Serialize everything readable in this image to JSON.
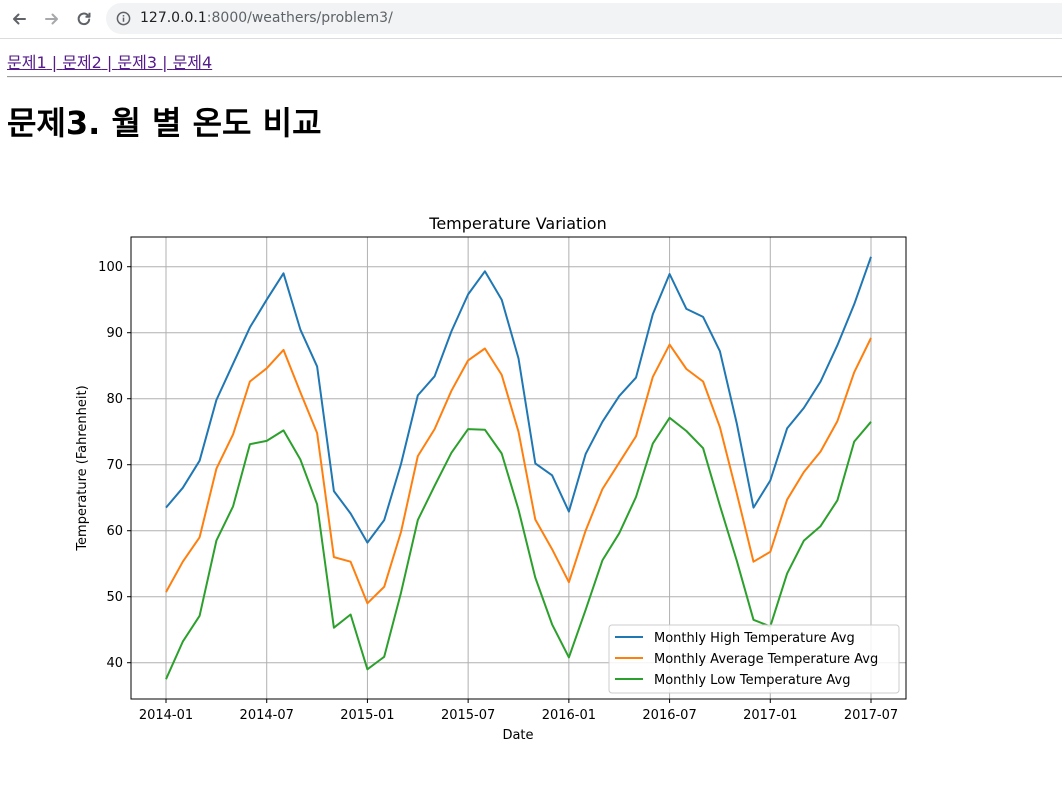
{
  "browser": {
    "url_host": "127.0.0.1",
    "url_path": ":8000/weathers/problem3/",
    "back_icon": "arrow-left-icon",
    "forward_icon": "arrow-right-icon",
    "reload_icon": "reload-icon",
    "info_icon": "info-icon"
  },
  "nav": {
    "links": [
      "문제1",
      "문제2",
      "문제3",
      "문제4"
    ],
    "separator": " | "
  },
  "page": {
    "title": "문제3. 월 별 온도 비교"
  },
  "colors": {
    "high": "#1f77b4",
    "avg": "#ff7f0e",
    "low": "#2ca02c",
    "grid": "#b0b0b0"
  },
  "chart_data": {
    "type": "line",
    "title": "Temperature Variation",
    "xlabel": "Date",
    "ylabel": "Temperature (Fahrenheit)",
    "x_start": "2014-01",
    "x": [
      "2014-01",
      "2014-02",
      "2014-03",
      "2014-04",
      "2014-05",
      "2014-06",
      "2014-07",
      "2014-08",
      "2014-09",
      "2014-10",
      "2014-11",
      "2014-12",
      "2015-01",
      "2015-02",
      "2015-03",
      "2015-04",
      "2015-05",
      "2015-06",
      "2015-07",
      "2015-08",
      "2015-09",
      "2015-10",
      "2015-11",
      "2015-12",
      "2016-01",
      "2016-02",
      "2016-03",
      "2016-04",
      "2016-05",
      "2016-06",
      "2016-07",
      "2016-08",
      "2016-09",
      "2016-10",
      "2016-11",
      "2016-12",
      "2017-01",
      "2017-02",
      "2017-03",
      "2017-04",
      "2017-05",
      "2017-06",
      "2017-07"
    ],
    "xticks": [
      "2014-01",
      "2014-07",
      "2015-01",
      "2015-07",
      "2016-01",
      "2016-07",
      "2017-01",
      "2017-07"
    ],
    "yticks": [
      40,
      50,
      60,
      70,
      80,
      90,
      100
    ],
    "ylim": [
      34.5,
      104.5
    ],
    "grid": true,
    "legend_position": "lower right",
    "series": [
      {
        "name": "Monthly High Temperature Avg",
        "color": "#1f77b4",
        "values": [
          63.5,
          66.5,
          70.6,
          79.8,
          85.3,
          90.8,
          95.0,
          99.0,
          90.5,
          84.9,
          66.0,
          62.6,
          58.2,
          61.6,
          70.1,
          80.5,
          83.4,
          90.2,
          95.8,
          99.3,
          95.0,
          86.1,
          70.2,
          68.4,
          62.9,
          71.6,
          76.5,
          80.4,
          83.2,
          92.8,
          98.9,
          93.6,
          92.4,
          87.2,
          76.3,
          63.5,
          67.6,
          75.5,
          78.6,
          82.6,
          88.1,
          94.3,
          101.5
        ]
      },
      {
        "name": "Monthly Average Temperature Avg",
        "color": "#ff7f0e",
        "values": [
          50.7,
          55.3,
          59.0,
          69.4,
          74.6,
          82.6,
          84.6,
          87.4,
          81.0,
          74.8,
          56.0,
          55.3,
          49.0,
          51.5,
          59.8,
          71.3,
          75.4,
          81.2,
          85.8,
          87.6,
          83.6,
          75.0,
          61.7,
          57.2,
          52.2,
          60.0,
          66.3,
          70.3,
          74.3,
          83.3,
          88.2,
          84.5,
          82.6,
          75.7,
          65.7,
          55.3,
          56.8,
          64.7,
          68.9,
          72.0,
          76.6,
          84.0,
          89.2
        ]
      },
      {
        "name": "Monthly Low Temperature Avg",
        "color": "#2ca02c",
        "values": [
          37.5,
          43.2,
          47.1,
          58.5,
          63.7,
          73.1,
          73.6,
          75.2,
          70.8,
          64.0,
          45.3,
          47.3,
          39.0,
          40.9,
          50.6,
          61.6,
          66.8,
          71.8,
          75.4,
          75.3,
          71.7,
          63.2,
          52.9,
          45.8,
          40.8,
          48.0,
          55.5,
          59.6,
          65.1,
          73.2,
          77.1,
          75.1,
          72.5,
          63.8,
          55.5,
          46.5,
          45.5,
          53.5,
          58.5,
          60.7,
          64.6,
          73.5,
          76.5
        ]
      }
    ]
  }
}
